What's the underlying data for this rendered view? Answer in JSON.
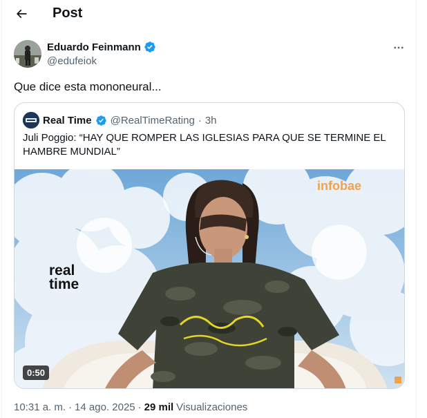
{
  "header": {
    "title": "Post",
    "back_icon": "arrow-left-icon"
  },
  "post": {
    "author": {
      "name": "Eduardo Feinmann",
      "handle": "@edufeiok",
      "verified": true
    },
    "text": "Que dice esta mononeural...",
    "more_icon": "more-horizontal-icon"
  },
  "quote": {
    "author": {
      "name": "Real Time",
      "handle": "@RealTimeRating",
      "separator": "·",
      "time": "3h",
      "verified": true
    },
    "text": "Juli Poggio: “HAY QUE ROMPER LAS IGLESIAS PARA QUE SE TERMINE EL HAMBRE MUNDIAL”",
    "video": {
      "duration": "0:50",
      "brand_top_right": "infobae",
      "brand_left": "real time"
    }
  },
  "meta": {
    "time": "10:31 a. m.",
    "separator": "·",
    "date": "14 ago. 2025",
    "separator2": "·",
    "views_count": "29 mil",
    "views_label": "Visualizaciones"
  },
  "colors": {
    "verified": "#1d9bf0",
    "secondary_text": "#536471",
    "border": "#cfd9de",
    "brand_orange": "#f2a14b"
  }
}
